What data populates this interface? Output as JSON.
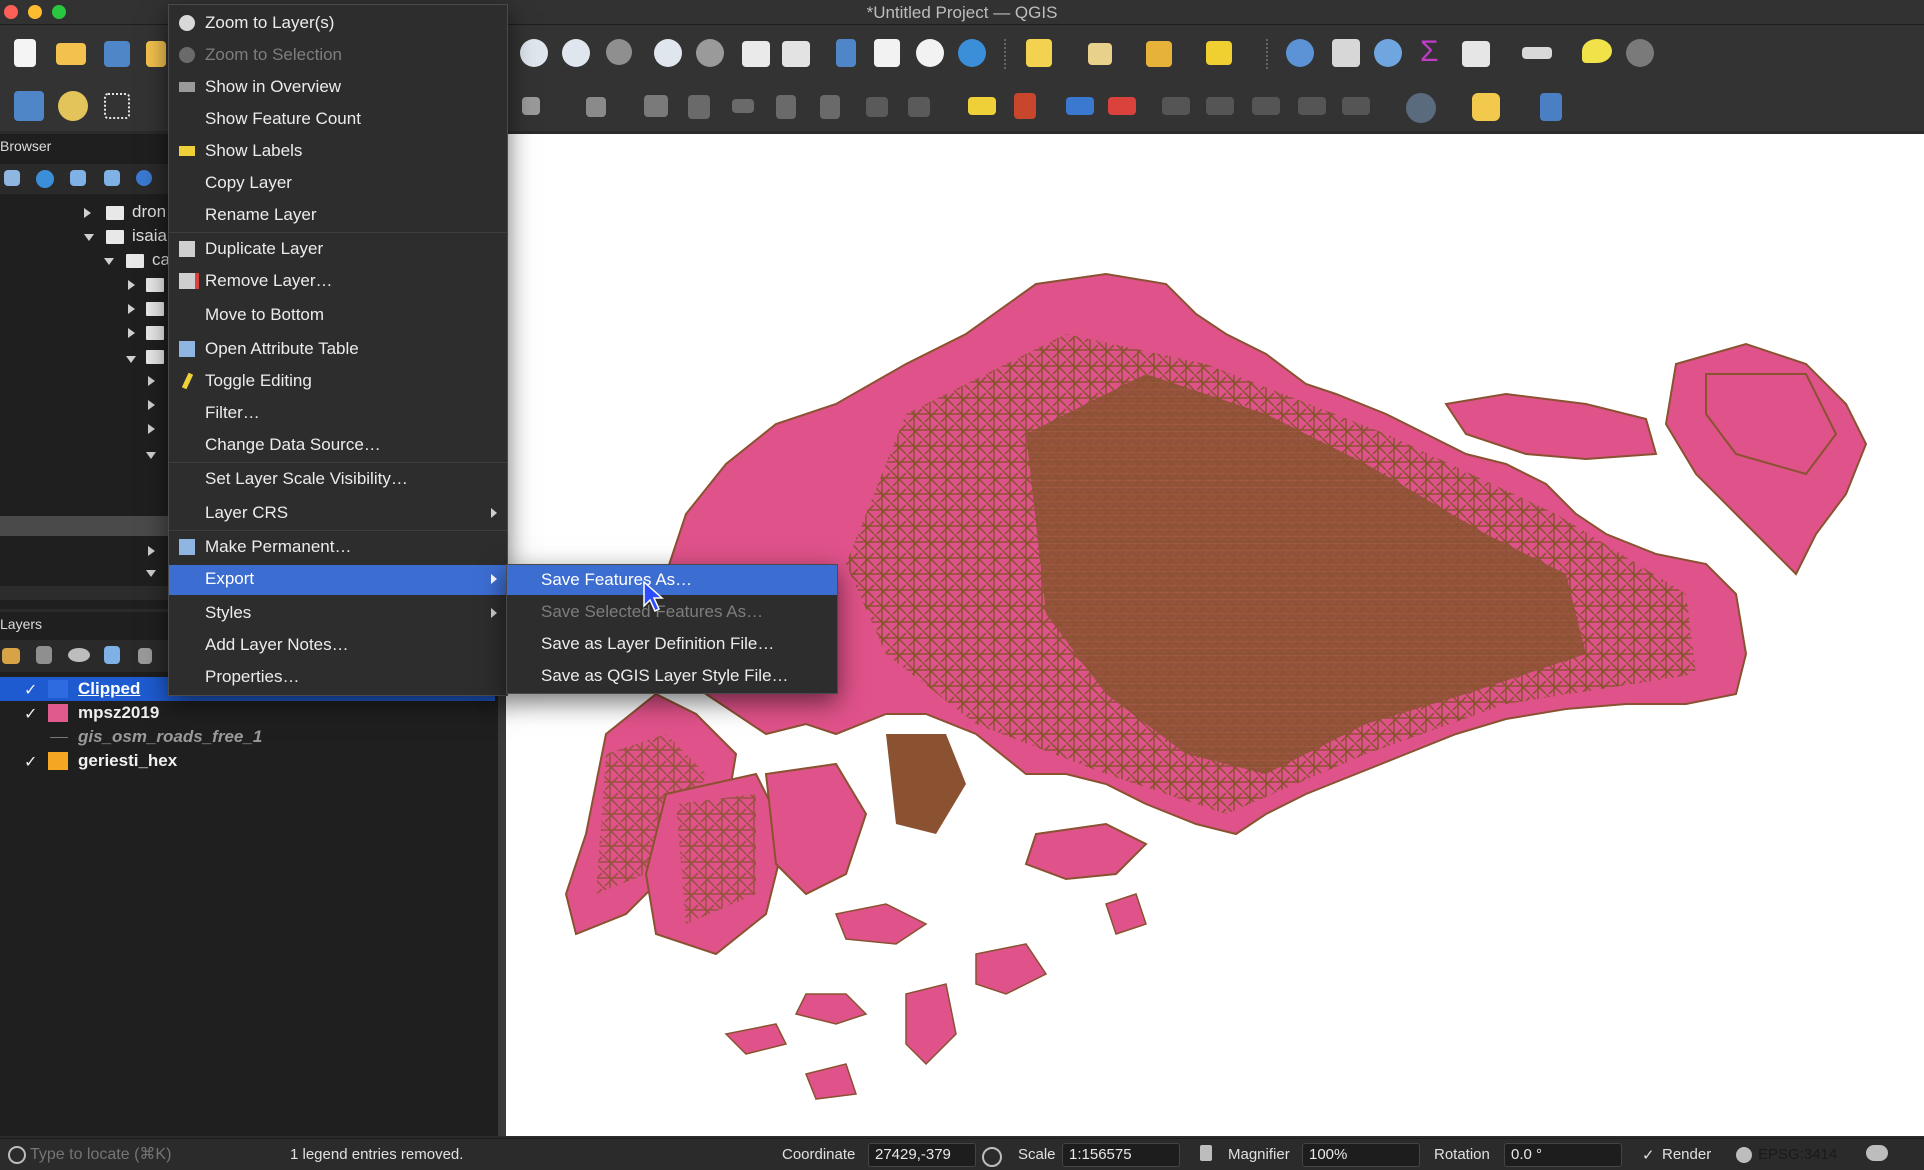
{
  "window": {
    "title": "*Untitled Project — QGIS"
  },
  "browser_panel": {
    "title": "Browser",
    "items": [
      "dron",
      "isaia",
      "ca"
    ]
  },
  "layers_panel": {
    "title": "Layers",
    "layers": [
      {
        "name": "Clipped",
        "checked": "✓",
        "color": "#2f6be0"
      },
      {
        "name": "mpsz2019",
        "checked": "✓",
        "color": "#e05a8e"
      },
      {
        "name": "gis_osm_roads_free_1",
        "checked": "",
        "color": ""
      },
      {
        "name": "geriesti_hex",
        "checked": "✓",
        "color": "#f5a623"
      }
    ]
  },
  "context_menu": {
    "items": [
      {
        "label": "Zoom to Layer(s)",
        "icon": "zoom-layer-icon"
      },
      {
        "label": "Zoom to Selection",
        "icon": "zoom-selection-icon"
      },
      {
        "label": "Show in Overview",
        "icon": "overview-icon"
      },
      {
        "label": "Show Feature Count",
        "icon": ""
      },
      {
        "label": "Show Labels",
        "icon": "labels-icon"
      },
      {
        "label": "Copy Layer",
        "icon": ""
      },
      {
        "label": "Rename Layer",
        "icon": ""
      },
      {
        "label": "Duplicate Layer",
        "icon": "duplicate-icon"
      },
      {
        "label": "Remove Layer…",
        "icon": "remove-icon"
      },
      {
        "label": "Move to Bottom",
        "icon": ""
      },
      {
        "label": "Open Attribute Table",
        "icon": "table-icon"
      },
      {
        "label": "Toggle Editing",
        "icon": "pencil-icon"
      },
      {
        "label": "Filter…",
        "icon": ""
      },
      {
        "label": "Change Data Source…",
        "icon": ""
      },
      {
        "label": "Set Layer Scale Visibility…",
        "icon": ""
      },
      {
        "label": "Layer CRS",
        "icon": ""
      },
      {
        "label": "Make Permanent…",
        "icon": "save-icon"
      },
      {
        "label": "Export",
        "icon": ""
      },
      {
        "label": "Styles",
        "icon": ""
      },
      {
        "label": "Add Layer Notes…",
        "icon": ""
      },
      {
        "label": "Properties…",
        "icon": ""
      }
    ]
  },
  "export_submenu": {
    "items": [
      {
        "label": "Save Features As…"
      },
      {
        "label": "Save Selected Features As…"
      },
      {
        "label": "Save as Layer Definition File…"
      },
      {
        "label": "Save as QGIS Layer Style File…"
      }
    ]
  },
  "status_bar": {
    "locate_placeholder": "Type to locate (⌘K)",
    "message": "1 legend entries removed.",
    "coordinate_label": "Coordinate",
    "coordinate_value": "27429,-379",
    "scale_label": "Scale",
    "scale_value": "1:156575",
    "magnifier_label": "Magnifier",
    "magnifier_value": "100%",
    "rotation_label": "Rotation",
    "rotation_value": "0.0 °",
    "render_label": "Render",
    "render_checked": "✓",
    "crs": "EPSG:3414"
  },
  "colors": {
    "land_fill": "#e0528a",
    "road_stroke": "#8a5230",
    "menu_highlight": "#3c6dd1"
  }
}
